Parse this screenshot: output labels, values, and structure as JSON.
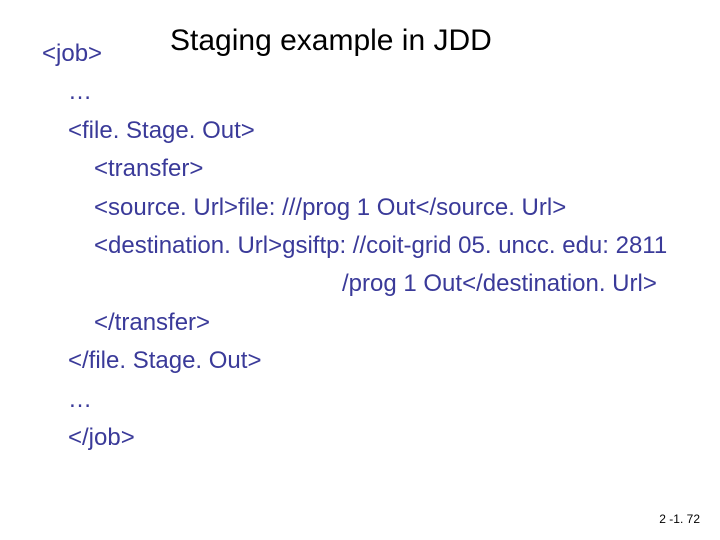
{
  "title": "Staging example in JDD",
  "code": {
    "l1": "<job>",
    "l2": "…",
    "l3": "<file. Stage. Out>",
    "l4": "<transfer>",
    "l5": "<source. Url>file: ///prog 1 Out</source. Url>",
    "l6": "<destination. Url>gsiftp: //coit-grid 05. uncc. edu: 2811",
    "l7": "/prog 1 Out</destination. Url>",
    "l8": "</transfer>",
    "l9": "</file. Stage. Out>",
    "l10": "…",
    "l11": "</job>"
  },
  "footer": "2 -1. 72"
}
